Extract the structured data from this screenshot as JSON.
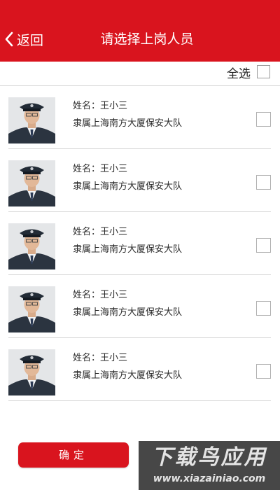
{
  "header": {
    "back_label": "返回",
    "title": "请选择上岗人员",
    "background_color": "#d9141e"
  },
  "select_all": {
    "label": "全选",
    "checked": false
  },
  "personnel": [
    {
      "name": "姓名：王小三",
      "unit": "隶属上海南方大厦保安大队",
      "checked": false
    },
    {
      "name": "姓名：王小三",
      "unit": "隶属上海南方大厦保安大队",
      "checked": false
    },
    {
      "name": "姓名：王小三",
      "unit": "隶属上海南方大厦保安大队",
      "checked": false
    },
    {
      "name": "姓名：王小三",
      "unit": "隶属上海南方大厦保安大队",
      "checked": false
    },
    {
      "name": "姓名：王小三",
      "unit": "隶属上海南方大厦保安大队",
      "checked": false
    }
  ],
  "footer": {
    "confirm_label": "确定"
  },
  "watermark": {
    "title": "下载鸟应用",
    "url": "www.xiazainiao.com"
  }
}
